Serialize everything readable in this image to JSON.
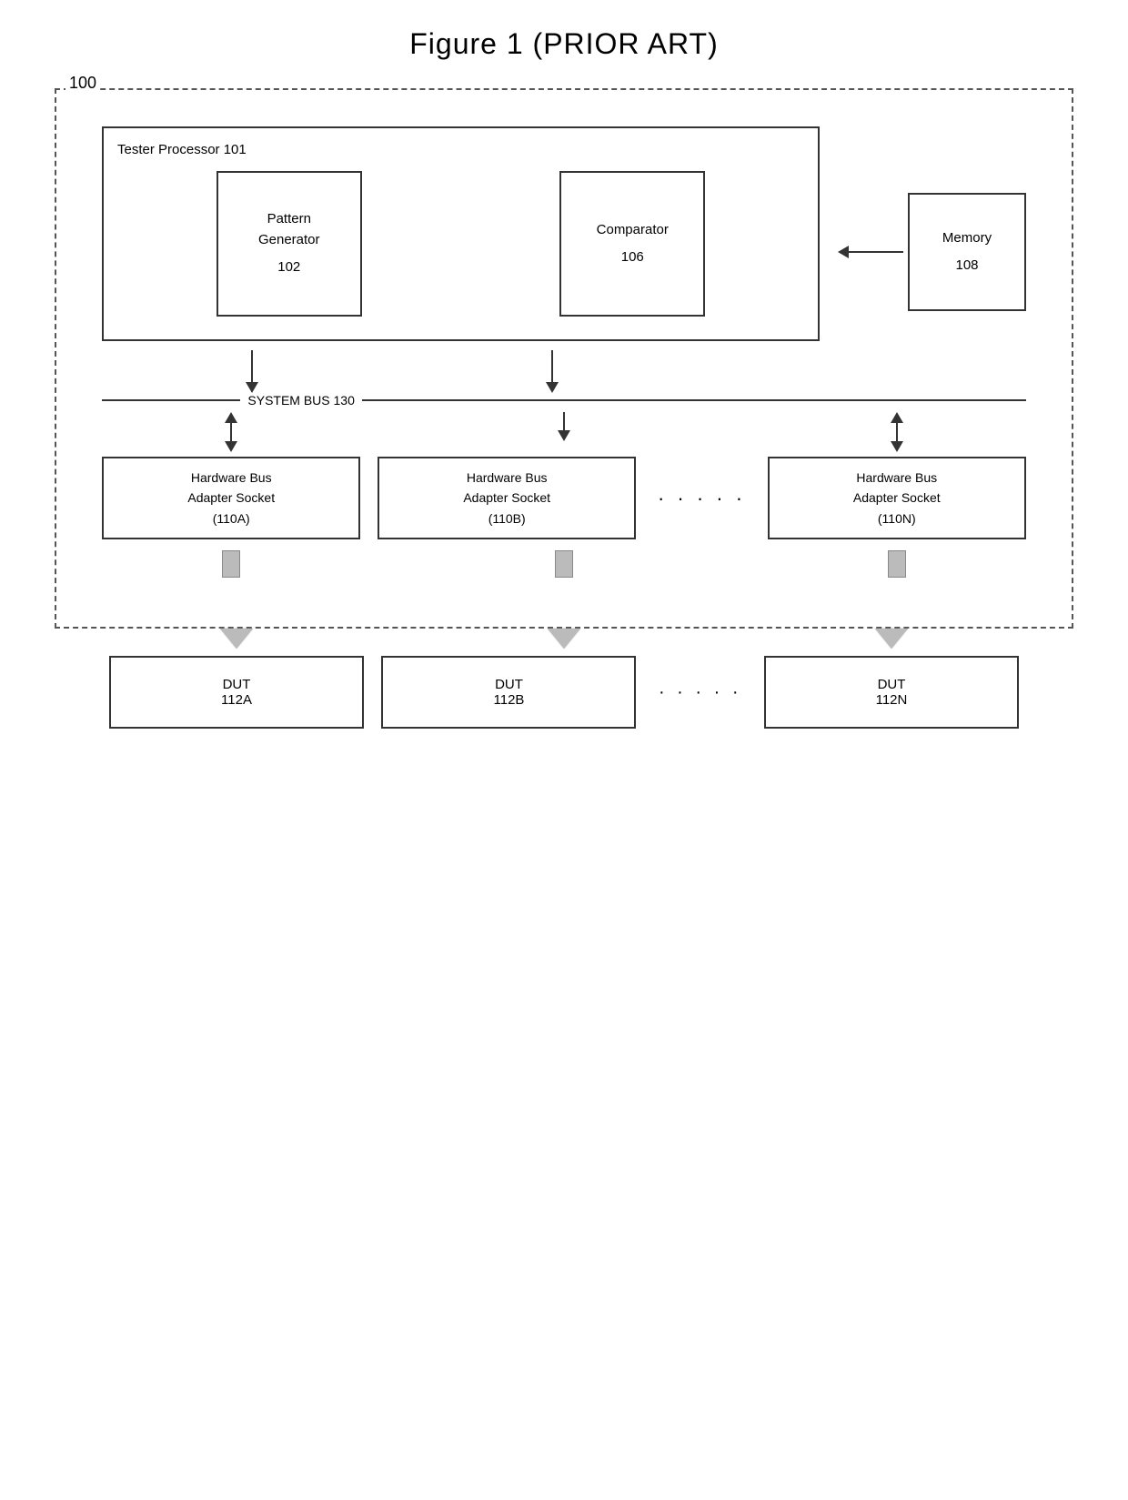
{
  "title": "Figure 1  (PRIOR ART)",
  "system_label": "100",
  "tester_processor": {
    "label": "Tester Processor 101",
    "pattern_generator": {
      "line1": "Pattern",
      "line2": "Generator",
      "number": "102"
    },
    "comparator": {
      "label": "Comparator",
      "number": "106"
    }
  },
  "memory": {
    "line1": "Memory",
    "number": "108"
  },
  "system_bus": {
    "label": "SYSTEM BUS 130"
  },
  "adapters": [
    {
      "line1": "Hardware Bus",
      "line2": "Adapter Socket",
      "id": "(110A)"
    },
    {
      "line1": "Hardware Bus",
      "line2": "Adapter Socket",
      "id": "(110B)"
    },
    {
      "line1": "Hardware Bus",
      "line2": "Adapter Socket",
      "id": "(110N)"
    }
  ],
  "duts": [
    {
      "label": "DUT",
      "number": "112A"
    },
    {
      "label": "DUT",
      "number": "112B"
    },
    {
      "label": "DUT",
      "number": "112N"
    }
  ],
  "ellipsis": "· · · · ·"
}
